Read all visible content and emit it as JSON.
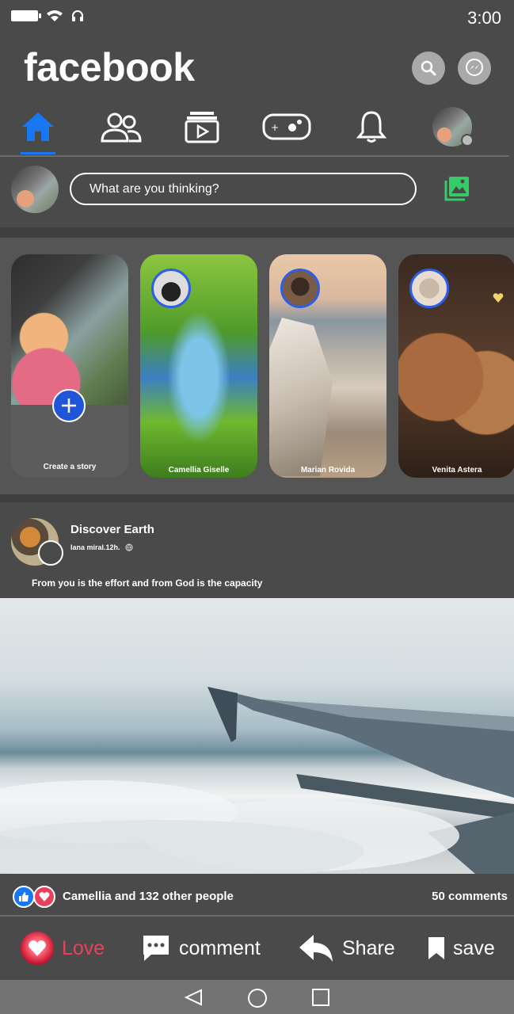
{
  "status": {
    "time": "3:00"
  },
  "header": {
    "brand": "facebook"
  },
  "composer": {
    "placeholder": "What are you thinking?"
  },
  "stories": [
    {
      "name": "Create a story"
    },
    {
      "name": "Camellia Giselle"
    },
    {
      "name": "Marian Rovida"
    },
    {
      "name": "Venita Astera"
    }
  ],
  "post": {
    "title": "Discover Earth",
    "meta": "lana miral.12h.",
    "text": "From you is the effort and from God is the capacity",
    "reactions_text": "Camellia and 132 other people",
    "comments": "50 comments"
  },
  "actions": {
    "love": "Love",
    "comment": "comment",
    "share": "Share",
    "save": "save"
  },
  "colors": {
    "accent": "#1877f2",
    "love": "#e8415e",
    "photo": "#33cc66"
  }
}
